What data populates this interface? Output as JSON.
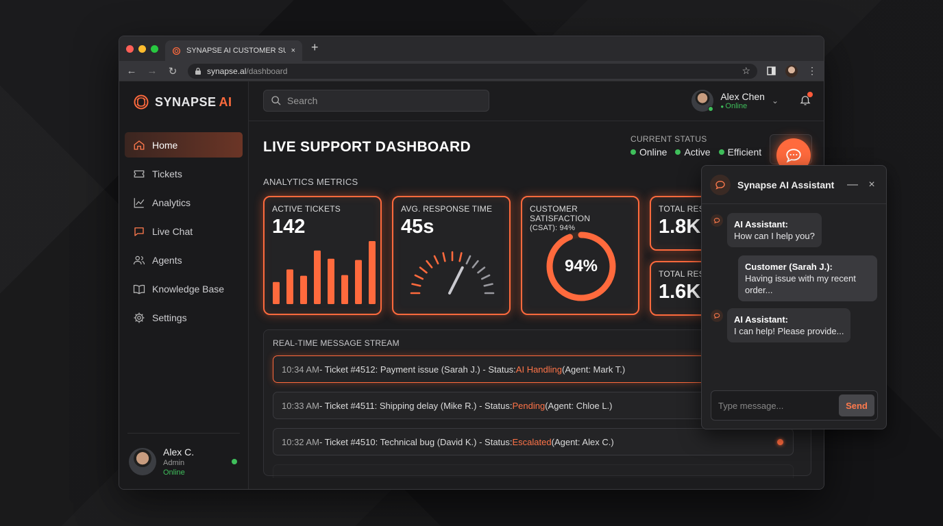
{
  "browser": {
    "tab_title": "SYNAPSE AI CUSTOMER SUPPORT",
    "url_host": "synapse.al",
    "url_path": "/dashboard",
    "new_tab": "+",
    "close_tab": "×"
  },
  "brand": {
    "name": "SYNAPSE",
    "accent": "AI"
  },
  "sidebar": {
    "items": [
      {
        "label": "Home",
        "icon": "home-icon",
        "active": true
      },
      {
        "label": "Tickets",
        "icon": "ticket-icon"
      },
      {
        "label": "Analytics",
        "icon": "chart-icon"
      },
      {
        "label": "Live Chat",
        "icon": "chat-icon"
      },
      {
        "label": "Agents",
        "icon": "users-icon"
      },
      {
        "label": "Knowledge Base",
        "icon": "book-icon"
      },
      {
        "label": "Settings",
        "icon": "gear-icon"
      }
    ],
    "user": {
      "name": "Alex C.",
      "role": "Admin",
      "status": "Online"
    }
  },
  "topbar": {
    "search_placeholder": "Search",
    "user_name": "Alex Chen",
    "user_status": "Online"
  },
  "page": {
    "title": "LIVE SUPPORT DASHBOARD",
    "status_label": "CURRENT STATUS",
    "statuses": [
      "Online",
      "Active",
      "Efficient"
    ],
    "metrics_label": "ANALYTICS METRICS"
  },
  "metrics": {
    "active_tickets": {
      "label": "ACTIVE TICKETS",
      "value": "142",
      "bars": [
        0.35,
        0.55,
        0.45,
        0.85,
        0.72,
        0.46,
        0.7,
        1.0
      ]
    },
    "response_time": {
      "label": "AVG. RESPONSE TIME",
      "value": "45s",
      "gauge_fraction": 0.62
    },
    "csat": {
      "label": "CUSTOMER SATISFACTION",
      "sublabel": "(CSAT): 94%",
      "value": "94%",
      "fraction": 0.94
    },
    "total_res_1": {
      "label": "TOTAL RESOLVED",
      "value": "1.8K"
    },
    "total_res_2": {
      "label": "TOTAL RESOLVED",
      "value": "1.6K"
    }
  },
  "stream": {
    "title": "REAL-TIME MESSAGE STREAM",
    "messages": [
      {
        "time": "10:34 AM",
        "text": " - Ticket #4512: Payment issue (Sarah J.) - Status: ",
        "status": "AI Handling",
        "agent": " (Agent: Mark T.)"
      },
      {
        "time": "10:33 AM",
        "text": " - Ticket #4511: Shipping delay (Mike R.) - Status: ",
        "status": "Pending",
        "agent": " (Agent: Chloe L.)"
      },
      {
        "time": "10:32 AM",
        "text": " - Ticket #4510: Technical bug (David K.) - Status: ",
        "status": "Escalated",
        "agent": " (Agent: Alex C.)"
      }
    ]
  },
  "chat": {
    "title": "Synapse AI Assistant",
    "messages": [
      {
        "sender": "AI Assistant:",
        "text": "How can I help you?"
      },
      {
        "sender": "Customer (Sarah J.):",
        "text": "Having issue with my recent order..."
      },
      {
        "sender": "AI Assistant:",
        "text": "I can help! Please provide..."
      }
    ],
    "input_placeholder": "Type message...",
    "send_label": "Send",
    "minimize": "—",
    "close": "×"
  },
  "colors": {
    "accent": "#ff6a3d",
    "online": "#3fbf5b",
    "background": "#1b1b1d"
  }
}
